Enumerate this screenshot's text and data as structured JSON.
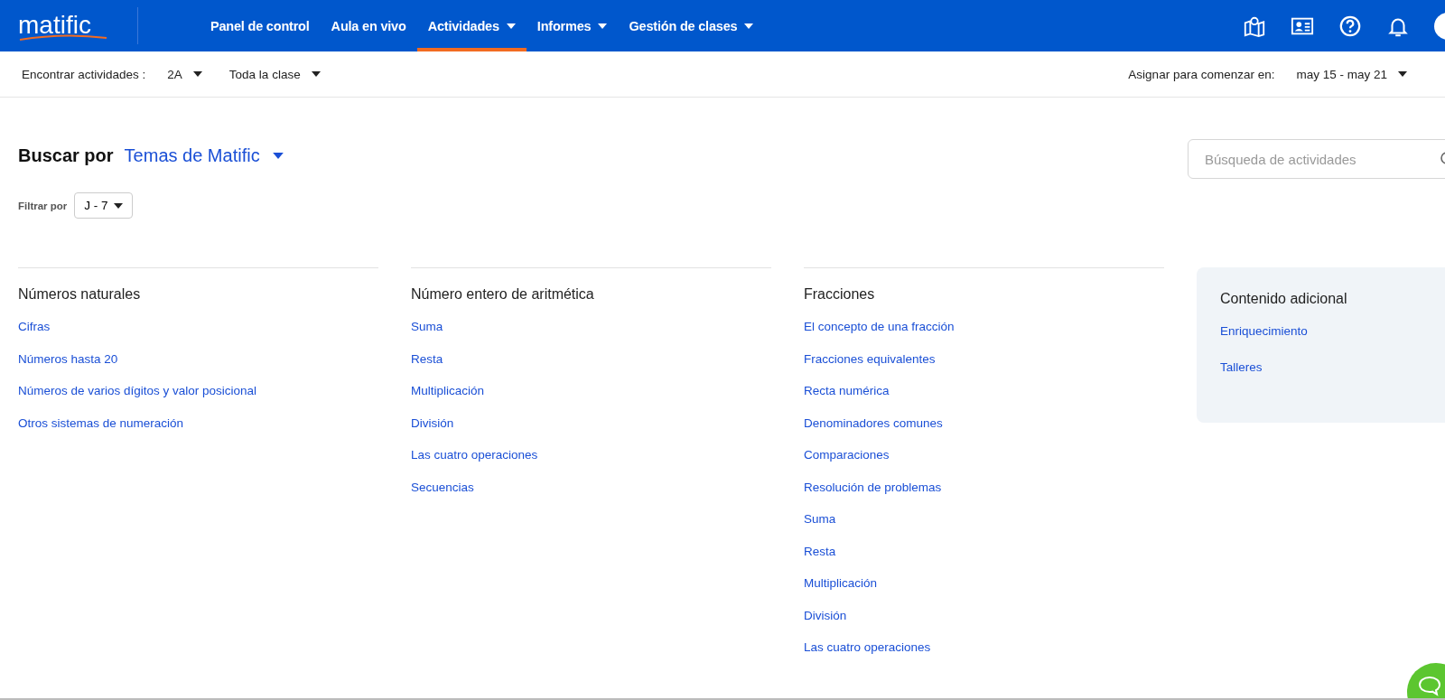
{
  "logo": "matific",
  "nav": [
    {
      "label": "Panel de control",
      "dropdown": false,
      "selected": false
    },
    {
      "label": "Aula en vivo",
      "dropdown": false,
      "selected": false
    },
    {
      "label": "Actividades",
      "dropdown": true,
      "selected": true
    },
    {
      "label": "Informes",
      "dropdown": true,
      "selected": false
    },
    {
      "label": "Gestión de clases",
      "dropdown": true,
      "selected": false
    }
  ],
  "toolbar": {
    "find_label": "Encontrar actividades :",
    "class": "2A",
    "group": "Toda la clase",
    "assign_label": "Asignar para comenzar en:",
    "date_range": "may 15 - may 21"
  },
  "browse": {
    "label": "Buscar por",
    "value": "Temas de Matific"
  },
  "search": {
    "placeholder": "Búsqueda de actividades"
  },
  "filter": {
    "label": "Filtrar por",
    "value": "J - 7"
  },
  "columns": [
    {
      "title": "Números naturales",
      "links": [
        "Cifras",
        "Números hasta 20",
        "Números de varios dígitos y valor posicional",
        "Otros sistemas de numeración"
      ]
    },
    {
      "title": "Número entero de aritmética",
      "links": [
        "Suma",
        "Resta",
        "Multiplicación",
        "División",
        "Las cuatro operaciones",
        "Secuencias"
      ]
    },
    {
      "title": "Fracciones",
      "links": [
        "El concepto de una fracción",
        "Fracciones equivalentes",
        "Recta numérica",
        "Denominadores comunes",
        "Comparaciones",
        "Resolución de problemas",
        "Suma",
        "Resta",
        "Multiplicación",
        "División",
        "Las cuatro operaciones"
      ]
    }
  ],
  "extra": {
    "title": "Contenido adicional",
    "links": [
      "Enriquecimiento",
      "Talleres"
    ]
  }
}
